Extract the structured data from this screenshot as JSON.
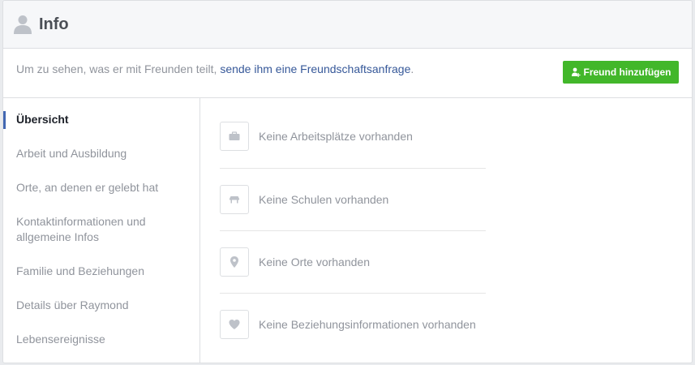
{
  "header": {
    "title": "Info",
    "icon": "person-icon"
  },
  "notice": {
    "prefix": "Um zu sehen, was er mit Freunden teilt, ",
    "link": "sende ihm eine Freundschaftsanfrage",
    "suffix": ".",
    "button_label": "Freund hinzufügen",
    "button_icon": "add-friend-icon",
    "button_color": "#42b72a",
    "link_color": "#365899"
  },
  "sidebar": {
    "items": [
      {
        "label": "Übersicht",
        "active": true
      },
      {
        "label": "Arbeit und Ausbildung"
      },
      {
        "label": "Orte, an denen er gelebt hat"
      },
      {
        "label": "Kontaktinformationen und allgemeine Infos"
      },
      {
        "label": "Familie und Beziehungen"
      },
      {
        "label": "Details über Raymond"
      },
      {
        "label": "Lebensereignisse"
      }
    ],
    "accent_color": "#4267b2"
  },
  "main": {
    "rows": [
      {
        "icon": "briefcase-icon",
        "label": "Keine Arbeitsplätze vorhanden"
      },
      {
        "icon": "school-icon",
        "label": "Keine Schulen vorhanden"
      },
      {
        "icon": "location-pin-icon",
        "label": "Keine Orte vorhanden"
      },
      {
        "icon": "heart-icon",
        "label": "Keine Beziehungsinformationen vorhanden"
      }
    ]
  }
}
